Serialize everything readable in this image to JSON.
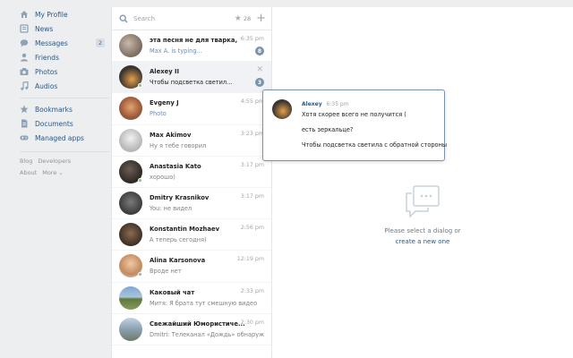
{
  "nav": {
    "items": [
      {
        "label": "My Profile",
        "icon": "home-icon"
      },
      {
        "label": "News",
        "icon": "news-icon"
      },
      {
        "label": "Messages",
        "icon": "messages-icon",
        "count": "2"
      },
      {
        "label": "Friends",
        "icon": "friends-icon"
      },
      {
        "label": "Photos",
        "icon": "camera-icon"
      },
      {
        "label": "Audios",
        "icon": "music-icon"
      }
    ],
    "items2": [
      {
        "label": "Bookmarks",
        "icon": "star-icon"
      },
      {
        "label": "Documents",
        "icon": "documents-icon"
      },
      {
        "label": "Managed apps",
        "icon": "gamepad-icon"
      }
    ],
    "footer": {
      "blog": "Blog",
      "developers": "Developers",
      "about": "About",
      "more": "More ⌄"
    }
  },
  "search": {
    "placeholder": "Search",
    "favorites_count": "28"
  },
  "dialogs": [
    {
      "name": "эта песня не для тварка,",
      "text": "Max A. is typing...",
      "time": "6:35 pm",
      "badge": "8",
      "style": "typing"
    },
    {
      "name": "Alexey II",
      "text": "Чтобы подсветка светил...",
      "time": "",
      "badge": "3",
      "style": "dark",
      "active": true
    },
    {
      "name": "Evgeny J",
      "text": "Photo",
      "time": "4:55 pm",
      "badge": "",
      "style": "blue"
    },
    {
      "name": "Max Akimov",
      "text": "Ну я тебе говорил",
      "time": "3:23 pm",
      "badge": "",
      "style": ""
    },
    {
      "name": "Anastasia Kato",
      "text": "хорошо)",
      "time": "3:17 pm",
      "badge": "",
      "style": ""
    },
    {
      "name": "Dmitry Krasnikov",
      "text": "You: не видел",
      "time": "3:17 pm",
      "badge": "",
      "style": ""
    },
    {
      "name": "Konstantin Mozhaev",
      "text": "А теперь сегодня)",
      "time": "2:56 pm",
      "badge": "",
      "style": ""
    },
    {
      "name": "Alina Karsonova",
      "text": "Вроде нет",
      "time": "12:19 pm",
      "badge": "",
      "style": ""
    },
    {
      "name": "Каковый чат",
      "text": "Митя: Я брата тут смешную видео",
      "time": "2:33 pm",
      "badge": "",
      "style": ""
    },
    {
      "name": "Свежайший Юмористиче...",
      "text": "Dmitri: Телеканал «Дождь» обнаружил...",
      "time": "2:30 pm",
      "badge": "",
      "style": ""
    }
  ],
  "popup": {
    "name": "Alexey",
    "time": "6:35 pm",
    "lines": [
      "Хотя скорее всего не получится (",
      "есть зеркальце?",
      "Чтобы подсветка светила с обратной стороны"
    ]
  },
  "empty": {
    "line1": "Please select a dialog or",
    "line2": "create a new one"
  },
  "colors": {
    "link": "#2a5885",
    "accent": "#7c93ad",
    "background": "#edeef0"
  }
}
